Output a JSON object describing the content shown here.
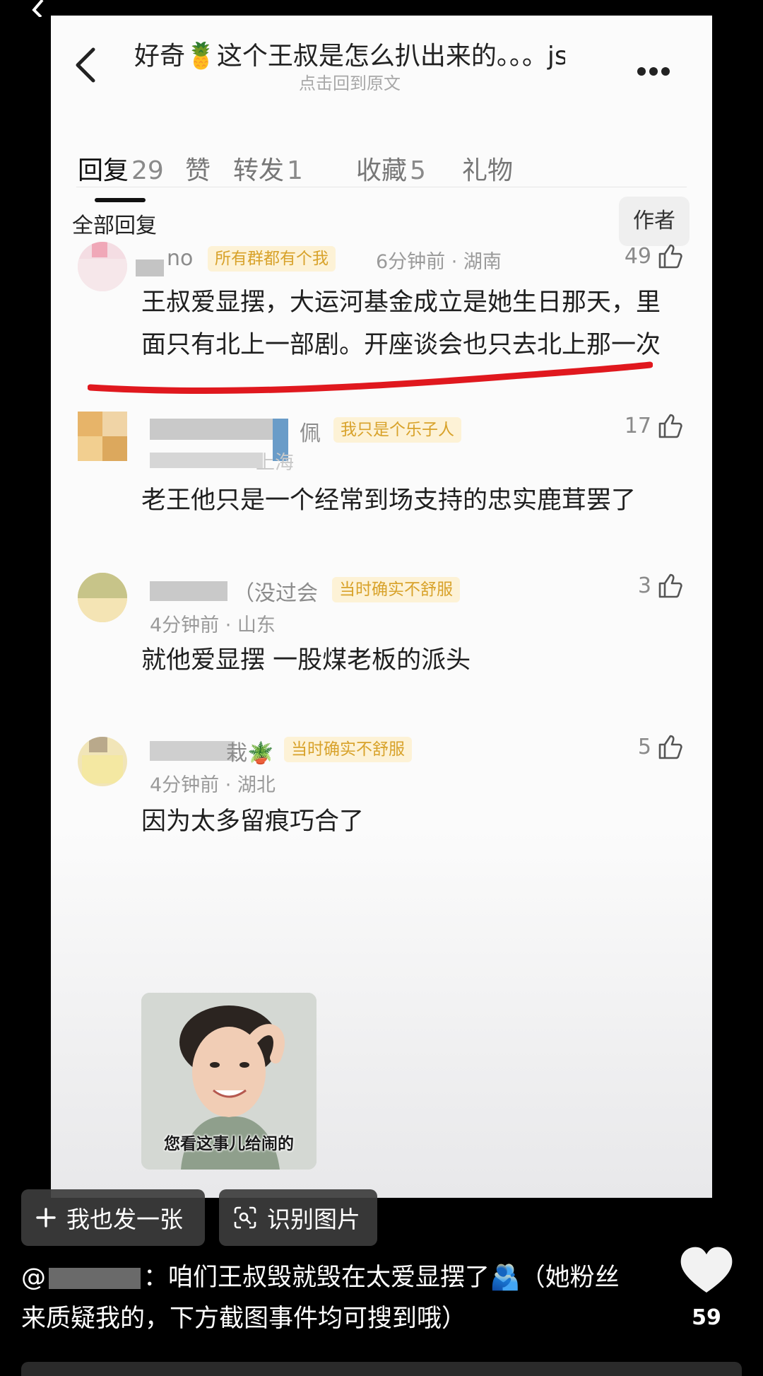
{
  "header": {
    "title": "好奇🍍这个王叔是怎么扒出来的。。。js…",
    "subtitle": "点击回到原文"
  },
  "tabs": [
    {
      "label": "回复",
      "count": "29"
    },
    {
      "label": "赞",
      "count": ""
    },
    {
      "label": "转发",
      "count": "1"
    },
    {
      "label": "收藏",
      "count": "5"
    },
    {
      "label": "礼物",
      "count": ""
    }
  ],
  "filter": {
    "all_replies": "全部回复",
    "author_button": "作者"
  },
  "comments": [
    {
      "name": "no",
      "badge": "所有群都有个我",
      "meta": "6分钟前 · 湖南",
      "likes": "49",
      "text": "王叔爱显摆，大运河基金成立是她生日那天，里面只有北上一部剧。开座谈会也只去北上那一次"
    },
    {
      "name": "佩",
      "badge": "我只是个乐子人",
      "meta": "上海",
      "likes": "17",
      "text": "老王他只是一个经常到场支持的忠实鹿茸罢了"
    },
    {
      "name": "（没过会",
      "badge": "当时确实不舒服",
      "meta": "4分钟前 · 山东",
      "likes": "3",
      "text": "就他爱显摆 一股煤老板的派头"
    },
    {
      "name": "栽🪴",
      "badge": "当时确实不舒服",
      "meta": "4分钟前 · 湖北",
      "likes": "5",
      "text": "因为太多留痕巧合了",
      "image_caption": "您看这事儿给闹的"
    }
  ],
  "actions": {
    "post_same": "我也发一张",
    "recognize": "识别图片"
  },
  "post": {
    "prefix": "@",
    "caption": "：咱们王叔毁就毁在太爱显摆了🫂（她粉丝来质疑我的，下方截图事件均可搜到哦）",
    "likes": "59"
  },
  "colors": {
    "highlight_line": "#e0181e",
    "badge_bg": "#fdf2d6",
    "badge_text": "#d8a22a"
  }
}
